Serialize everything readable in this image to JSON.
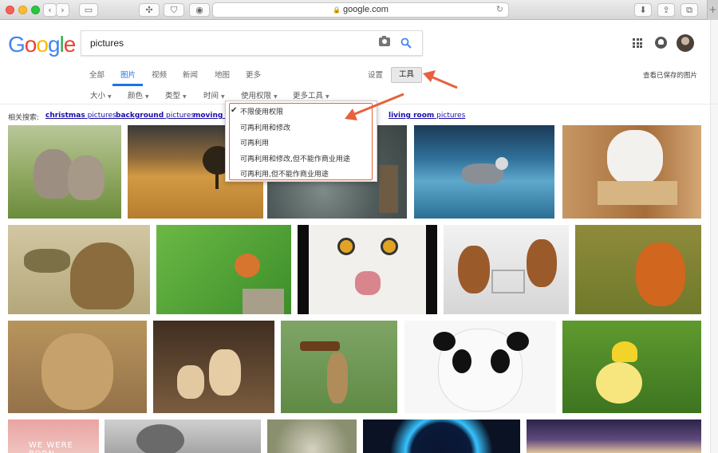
{
  "browser": {
    "url": "google.com"
  },
  "google": {
    "logo": [
      "G",
      "o",
      "o",
      "g",
      "l",
      "e"
    ],
    "search_value": "pictures",
    "tabs": [
      {
        "label": "全部",
        "active": false
      },
      {
        "label": "图片",
        "active": true
      },
      {
        "label": "视频",
        "active": false
      },
      {
        "label": "新闻",
        "active": false
      },
      {
        "label": "地图",
        "active": false
      },
      {
        "label": "更多",
        "active": false
      }
    ],
    "settings_label": "设置",
    "tools_label": "工具",
    "saved_label": "查看已保存的图片",
    "filters": [
      "大小",
      "颜色",
      "类型",
      "时间",
      "使用权限",
      "更多工具"
    ],
    "related_label": "相关搜索:",
    "related": [
      {
        "bold": "christmas",
        "rest": " pictures"
      },
      {
        "bold": "background",
        "rest": " pictures"
      },
      {
        "bold": "moving",
        "rest": " p"
      },
      {
        "bold": "living room",
        "rest": " pictures"
      }
    ],
    "usage_rights_menu": {
      "options": [
        "不限使用权限",
        "可再利用和修改",
        "可再利用",
        "可再利用和修改,但不能作商业用途",
        "可再利用,但不能作商业用途"
      ],
      "selected_index": 0
    }
  },
  "images": [
    "kittens",
    "field-tree-sunset",
    "deer-bokeh",
    "tree-stump",
    "husky-on-ice",
    "white-kitten",
    "bird-with-frog",
    "frog-and-robin",
    "snowy-owl",
    "squirrels-with-cart",
    "red-fox",
    "lion",
    "fennec-foxes",
    "frog-with-bottle",
    "panda",
    "chick-under-flower",
    "we-were-born",
    "smoke-cloud",
    "round-mirror",
    "planet-glow",
    "purple-sky"
  ],
  "colors": {
    "accent": "#1a73e8",
    "annotation": "#e8603c",
    "link": "#1a0dab"
  }
}
